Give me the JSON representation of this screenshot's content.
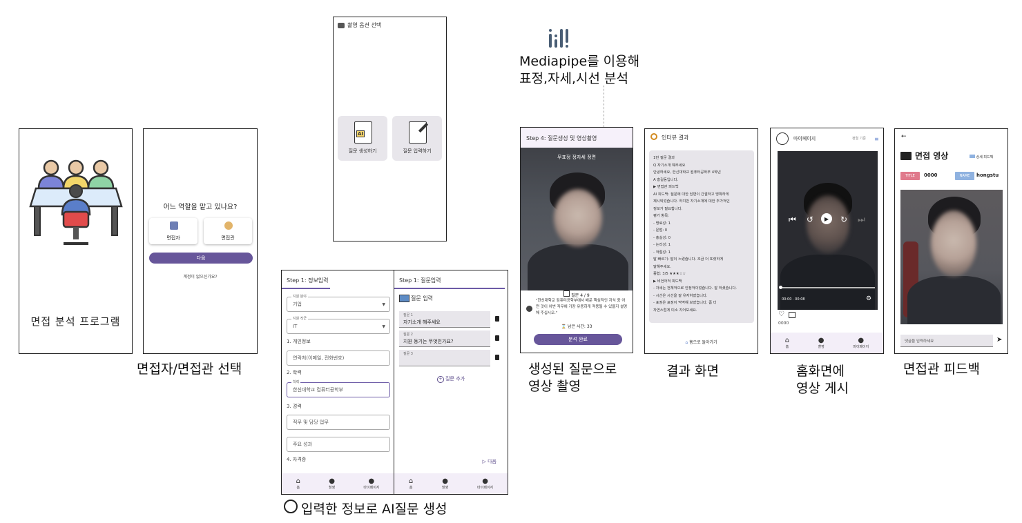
{
  "screen1": {
    "title": "면접 분석 프로그램"
  },
  "screen2": {
    "question": "어느 역할을 맡고 있나요?",
    "option1": "면접자",
    "option2": "면접관",
    "next_button": "다음",
    "link": "계정이 없으신가요?",
    "caption": "면접자/면접관 선택"
  },
  "screen3": {
    "header": "촬영 옵션 선택",
    "option1": "질문 생성하기",
    "option2": "질문 입력하기",
    "ai_badge": "AI"
  },
  "screen4": {
    "header": "Step 1: 정보입력",
    "field1_label": "지원 분야",
    "field1_value": "기업",
    "field2_label": "지원 직군",
    "field2_value": "IT",
    "section1": "1. 개인정보",
    "field3_placeholder": "연락처(이메일, 전화번호)",
    "section2": "2. 학력",
    "field4_label": "학력",
    "field4_value": "한신대학교 컴퓨터공학부",
    "section3": "3. 경력",
    "field5_placeholder": "직무 및 담당 업무",
    "field6_placeholder": "주요 성과",
    "section4": "4. 자격증",
    "nav": [
      "홈",
      "촬영",
      "마이페이지"
    ]
  },
  "screen5": {
    "header": "Step 1: 질문입력",
    "sub_title": "질문 입력",
    "q1_label": "질문 1",
    "q1_value": "자기소개 해주세요",
    "q2_label": "질문 2",
    "q2_value": "지원 동기는 무엇인가요?",
    "q3_label": "질문 3",
    "add_question": "질문 추가",
    "next": "다음",
    "nav": [
      "홈",
      "촬영",
      "마이페이지"
    ],
    "caption": "입력한 정보로 AI질문 생성"
  },
  "annotation": {
    "line1": "Mediapipe를 이용해",
    "line2": "표정,자세,시선 분석"
  },
  "screen6": {
    "header": "Step 4: 질문생성 및 영상촬영",
    "overlay": "무표정 정자세 정면",
    "question_count": "질문 4 / 9",
    "question_text": "\"한신대학교 컴퓨터공학부에서 배운 핵심적인 지식 중 어떤 것이 이번 직무에 가장 유용하게 적용될 수 있을지 설명해 주십시오.\"",
    "timer": "남은 시간: 33",
    "complete_button": "분석 완료",
    "caption1": "생성된 질문으로",
    "caption2": "영상 촬영"
  },
  "screen7": {
    "header": "인터뷰 결과",
    "lines": [
      "1번 질문 결과",
      "Q 자기소개 해주세요",
      "  안녕하세요, 한신대학교 컴퓨터공학부 4학년",
      "A 홍길동입니다.",
      "▶ 면접관 피드백",
      "AI 피드백: 질문에 대한 답변이 간결하고 명확하게",
      "제시되었습니다. 하지만 자기소개에 대한 추가적인",
      "정보가 필요합니다.",
      "평가 항목:",
      "- 명료성: 1",
      "- 문법: 0",
      "- 충실성: 0",
      "- 논리성: 1",
      "- 적절성: 1",
      "말 빠르기: 말이 느렸습니다. 조금 더 또렷하게",
      "말해주세요.",
      "종합: 3/5 ★★★☆☆",
      "▶ 비언어적 피드백",
      "- 자세는 전체적으로 안정적이었습니다. 잘 하셨습니다.",
      "- 시선은 시선을 잘 유지하였습니다.",
      "- 표정은 표정이 딱딱해 보였습니다. 좀 더",
      "  자연스럽게 미소 지어보세요."
    ],
    "home_link": "홈으로 돌아가기",
    "caption": "결과 화면"
  },
  "screen8": {
    "header": "마이페이지",
    "right_label": "정렬 기준",
    "time": "00:00 · 00:08",
    "count": "0000",
    "nav": [
      "홈",
      "촬영",
      "마이페이지"
    ],
    "caption1": "홈화면에",
    "caption2": "영상 게시"
  },
  "screen9": {
    "back": "←",
    "title": "면접 영상",
    "badge_right": "상세 피드백",
    "title_tag": "TITLE",
    "title_value": "0000",
    "name_tag": "NAME",
    "name_value": "hongstu",
    "comment_placeholder": "댓글을 입력하세요",
    "caption": "면접관 피드백"
  },
  "colors": {
    "accent_purple": "#67569a",
    "nav_bg": "#f3eef8",
    "card_gray": "#e8e6eb"
  }
}
